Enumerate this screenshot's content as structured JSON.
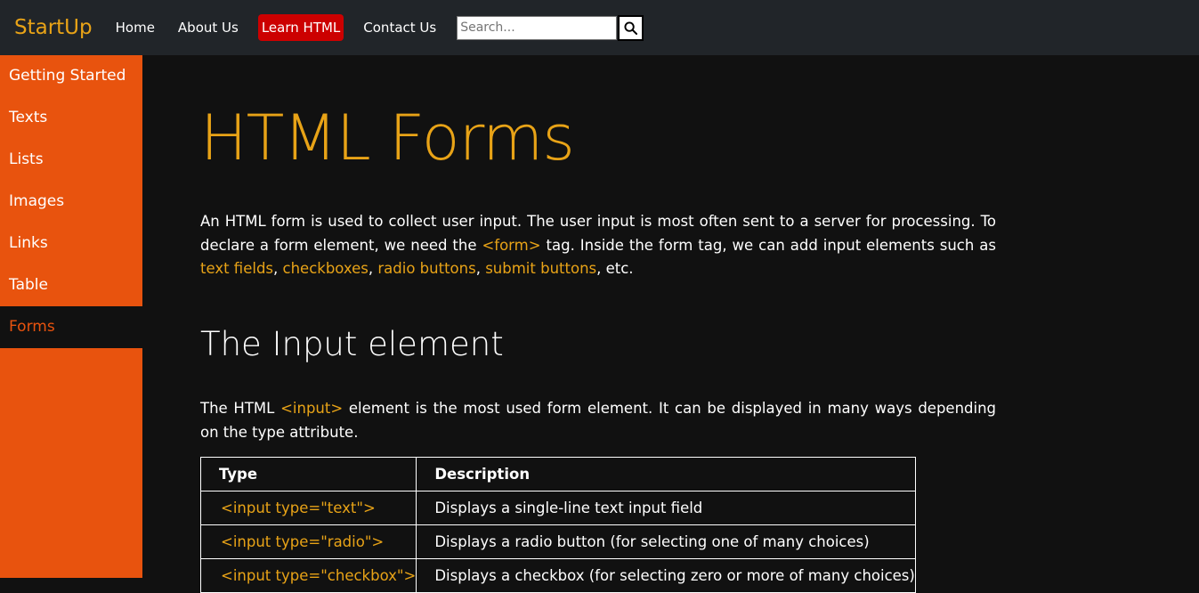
{
  "navbar": {
    "brand": "StartUp",
    "links": [
      {
        "label": "Home"
      },
      {
        "label": "About Us"
      },
      {
        "label": "Learn HTML"
      },
      {
        "label": "Contact Us"
      }
    ],
    "search_placeholder": "Search...",
    "search_icon": "search-icon",
    "active_link_color": "#cc0000"
  },
  "sidebar": {
    "items": [
      {
        "label": "Getting Started"
      },
      {
        "label": "Texts"
      },
      {
        "label": "Lists"
      },
      {
        "label": "Images"
      },
      {
        "label": "Links"
      },
      {
        "label": "Table"
      },
      {
        "label": "Forms"
      }
    ],
    "active_item": "Forms",
    "background_color": "#e8530e"
  },
  "main": {
    "title": "HTML Forms",
    "intro": {
      "t1": "An HTML form is used to collect user input. The user input is most often sent to a server for processing. To declare a form element, we need the ",
      "code_form": "<form>",
      "t2": " tag. Inside the form tag, we can add input elements such as ",
      "link_text_fields": "text fields",
      "sep1": ", ",
      "link_checkboxes": "checkboxes",
      "sep2": ", ",
      "link_radio": "radio buttons",
      "sep3": ", ",
      "link_submit": "submit buttons",
      "t3": ", etc."
    },
    "section_title": "The Input element",
    "input_para": {
      "t1": "The HTML ",
      "code_input": "<input>",
      "t2": " element is the most used form element. It can be displayed in many ways depending on the type attribute."
    },
    "table": {
      "headers": [
        "Type",
        "Description"
      ],
      "rows": [
        [
          "<input type=\"text\">",
          "Displays a single-line text input field"
        ],
        [
          "<input type=\"radio\">",
          "Displays a radio button (for selecting one of many choices)"
        ],
        [
          "<input type=\"checkbox\">",
          "Displays a checkbox (for selecting zero or more of many choices)"
        ]
      ]
    },
    "accent_color": "#e8a317"
  }
}
